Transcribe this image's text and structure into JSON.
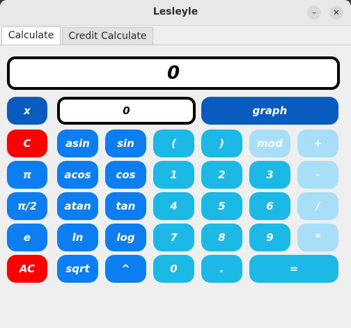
{
  "window": {
    "title": "Lesleyle",
    "minimize_label": "–",
    "close_label": "✕"
  },
  "tabs": [
    {
      "label": "Calculate",
      "active": true
    },
    {
      "label": "Credit Calculate",
      "active": false
    }
  ],
  "display": {
    "value": "0"
  },
  "graph_row": {
    "x_label": "x",
    "x_value": "0",
    "graph_label": "graph"
  },
  "keys": {
    "row1": [
      "C",
      "asin",
      "sin",
      "(",
      ")",
      "mod",
      "+"
    ],
    "row2": [
      "π",
      "acos",
      "cos",
      "1",
      "2",
      "3",
      "-"
    ],
    "row3": [
      "π/2",
      "atan",
      "tan",
      "4",
      "5",
      "6",
      "/"
    ],
    "row4": [
      "e",
      "ln",
      "log",
      "7",
      "8",
      "9",
      "*"
    ],
    "row5": [
      "AC",
      "sqrt",
      "^",
      "0",
      ".",
      "="
    ]
  },
  "colors": {
    "dark_blue": "#0a5bbf",
    "blue": "#0c7ef2",
    "red": "#ff0000",
    "cyan": "#1cb8e6",
    "pale_blue": "#a8def7"
  }
}
